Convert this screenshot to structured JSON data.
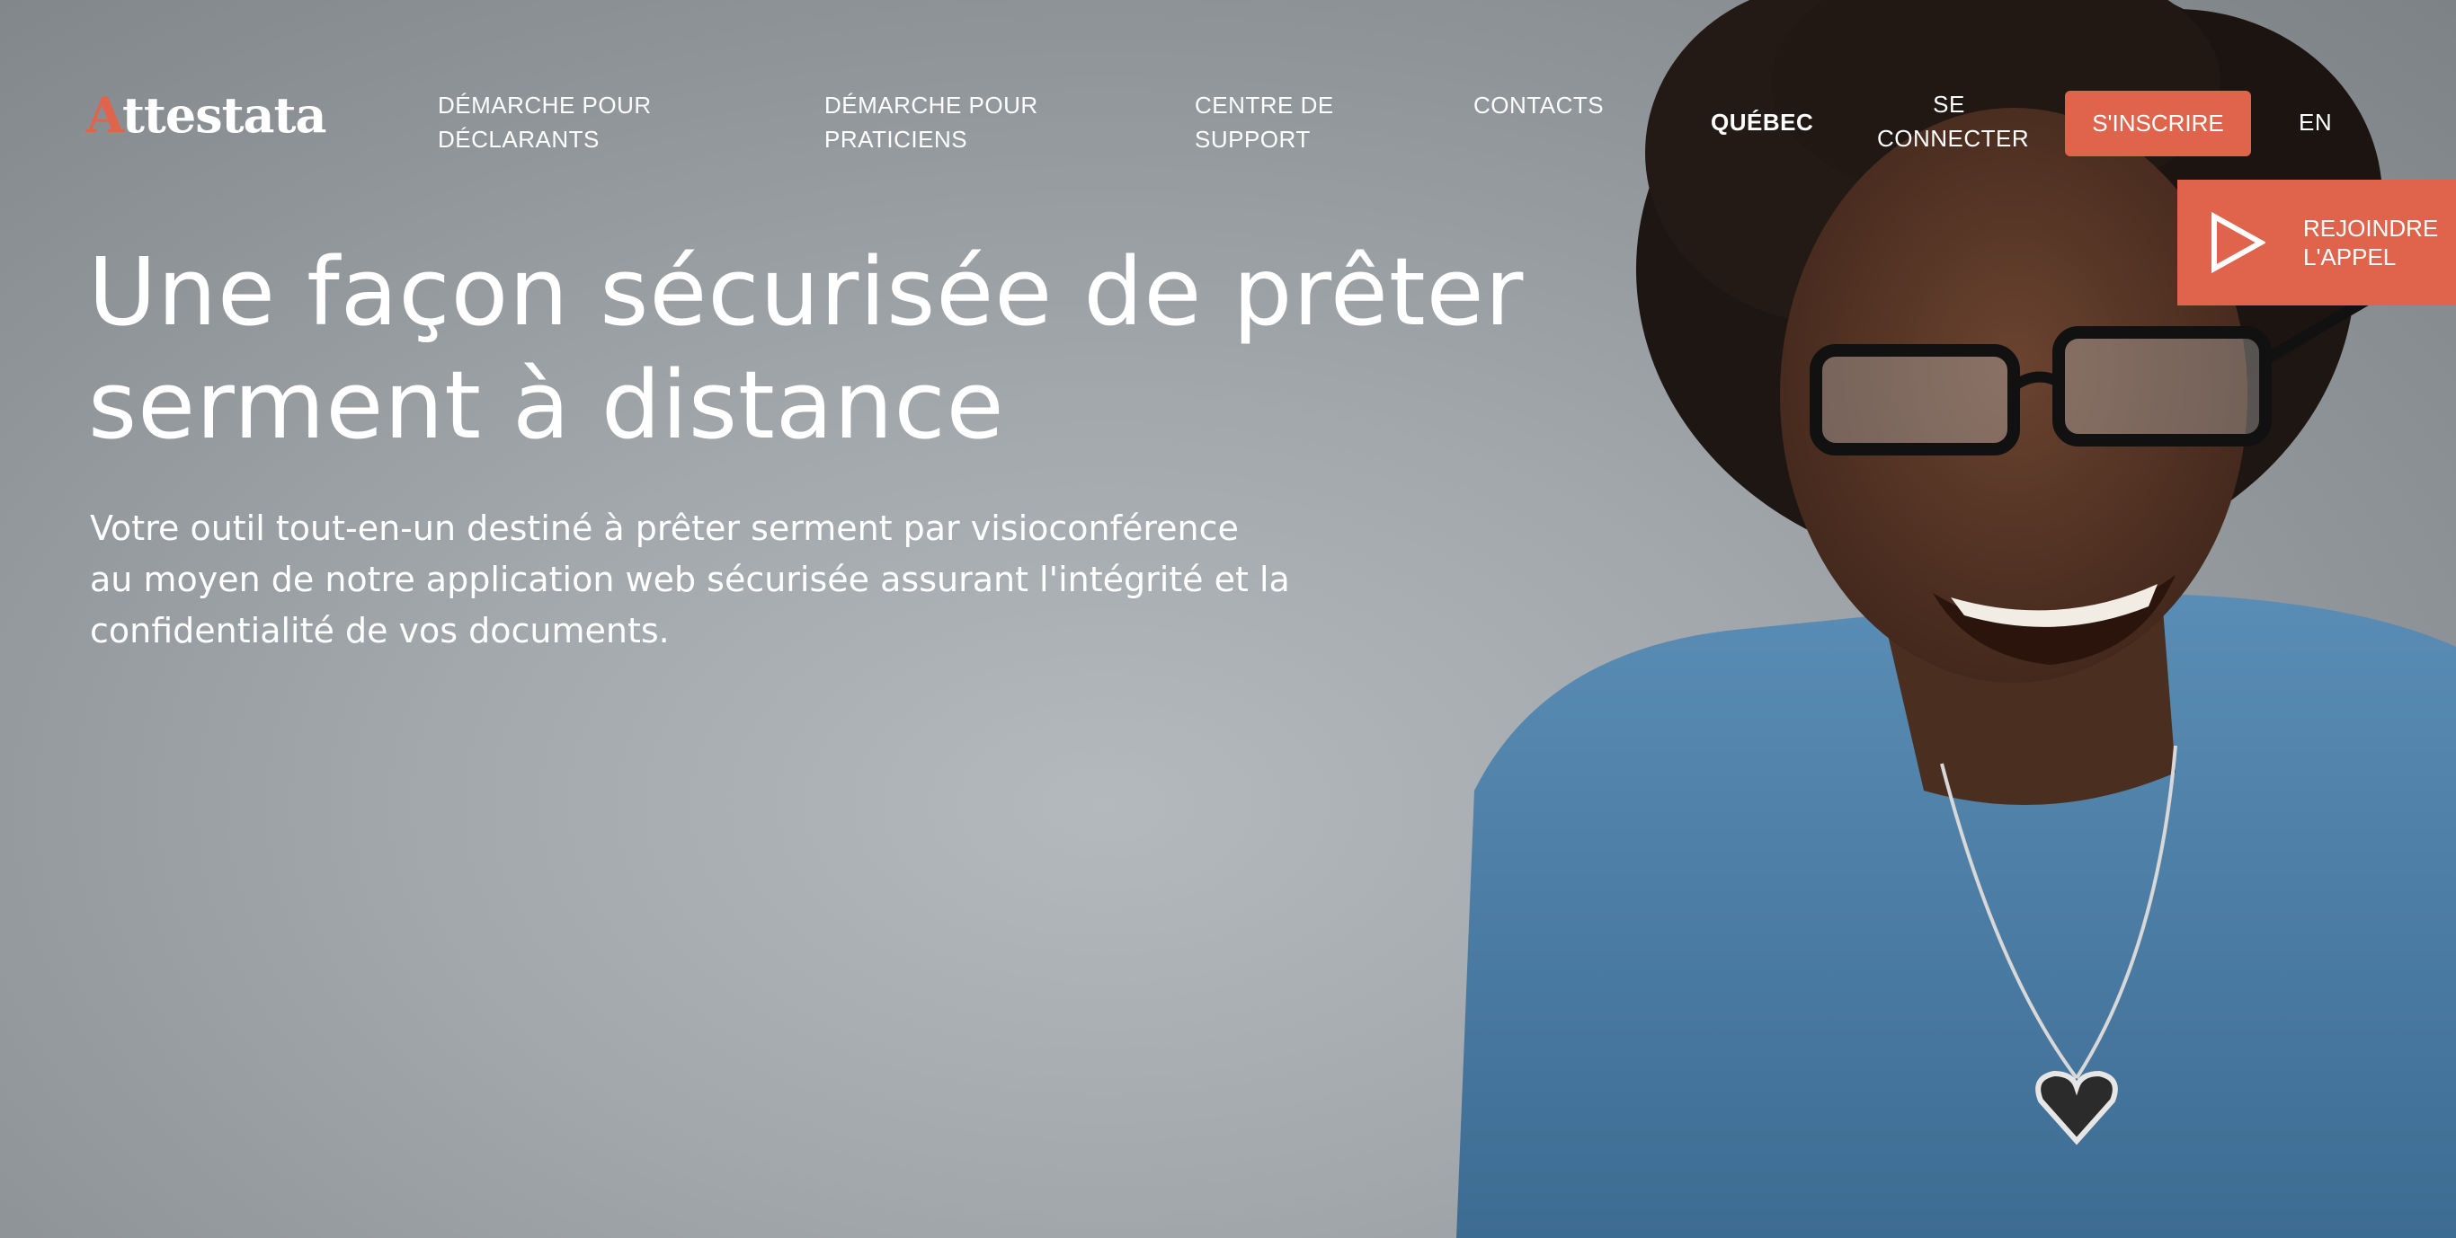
{
  "header": {
    "logo_initial": "A",
    "logo_rest": "ttestata",
    "nav": {
      "declarants_line1": "DÉMARCHE POUR",
      "declarants_line2": "DÉCLARANTS",
      "praticiens_line1": "DÉMARCHE POUR",
      "praticiens_line2": "PRATICIENS",
      "support_line1": "CENTRE DE",
      "support_line2": "SUPPORT",
      "contacts": "CONTACTS",
      "region": "QUÉBEC",
      "login_line1": "SE",
      "login_line2": "CONNECTER",
      "signup": "S'INSCRIRE",
      "language": "EN"
    }
  },
  "join_call": {
    "line1": "REJOINDRE",
    "line2": "L'APPEL",
    "icon": "play-icon"
  },
  "hero": {
    "headline_line1": "Une façon sécurisée de prêter",
    "headline_line2": "serment à distance",
    "subtitle_line1": "Votre outil tout-en-un destiné à prêter serment par visioconférence",
    "subtitle_line2": "au moyen de notre application web sécurisée assurant l'intégrité et la",
    "subtitle_line3": "confidentialité de vos documents.",
    "photo": "smiling-woman-with-glasses-photo"
  },
  "colors": {
    "accent": "#e0644c",
    "background": "#9ea3a7",
    "shirt": "#4a7fa8",
    "text": "#ffffff"
  }
}
